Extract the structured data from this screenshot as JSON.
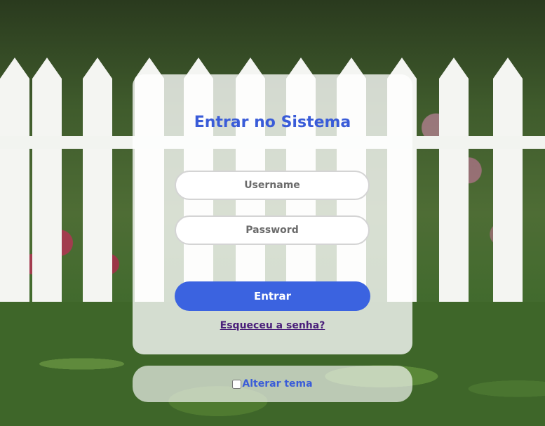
{
  "login": {
    "title": "Entrar no Sistema",
    "username_placeholder": "Username",
    "password_placeholder": "Password",
    "submit_label": "Entrar",
    "forgot_label": "Esqueceu a senha?"
  },
  "theme": {
    "toggle_label": "Alterar tema",
    "checked": false
  },
  "colors": {
    "accent": "#3b63e0",
    "title": "#3a5cd8",
    "link": "#4a1f7a"
  }
}
